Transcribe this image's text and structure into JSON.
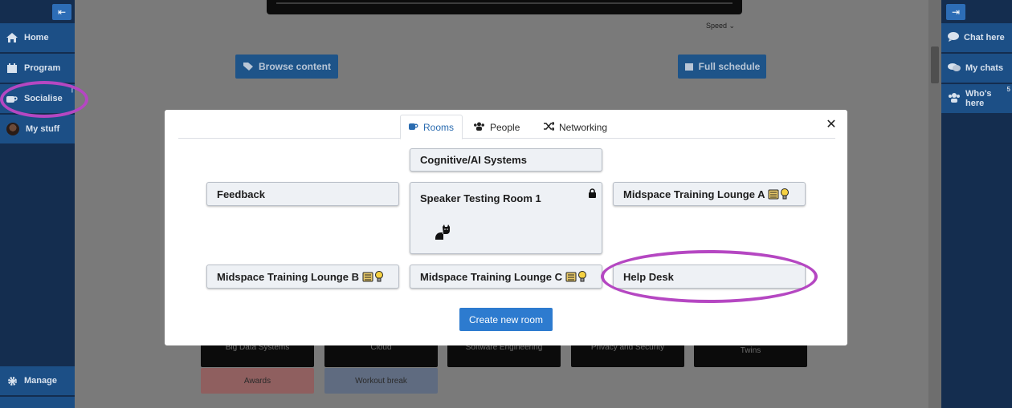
{
  "left_sidebar": {
    "collapse_label": "⇤",
    "items": [
      {
        "label": "Home",
        "icon": "home-icon"
      },
      {
        "label": "Program",
        "icon": "calendar-icon"
      },
      {
        "label": "Socialise",
        "icon": "coffee-icon"
      },
      {
        "label": "My stuff",
        "icon": "avatar"
      },
      {
        "label": "Manage",
        "icon": "gear-icon"
      }
    ]
  },
  "right_sidebar": {
    "items": [
      {
        "label": "Chat here",
        "icon": "chat-icon"
      },
      {
        "label": "My chats",
        "icon": "chats-icon"
      },
      {
        "label": "Who's here",
        "icon": "users-icon",
        "badge": "5"
      }
    ]
  },
  "video": {
    "speed_label": "Speed"
  },
  "main_buttons": {
    "browse_label": "Browse content",
    "schedule_label": "Full schedule"
  },
  "background_tiles": {
    "row1": [
      "Big Data Systems",
      "Cloud",
      "Software Engineering",
      "Privacy and Security",
      "Twins"
    ],
    "awards": "Awards",
    "workout": "Workout break"
  },
  "modal": {
    "tabs": [
      {
        "label": "Rooms",
        "active": true
      },
      {
        "label": "People",
        "active": false
      },
      {
        "label": "Networking",
        "active": false
      }
    ],
    "rooms": {
      "cognitive": "Cognitive/AI Systems",
      "feedback": "Feedback",
      "speaker": "Speaker Testing Room 1",
      "lounge_a": "Midspace Training Lounge A",
      "lounge_b": "Midspace Training Lounge B",
      "lounge_c": "Midspace Training Lounge C",
      "help_desk": "Help Desk"
    },
    "create_label": "Create new room"
  },
  "colors": {
    "accent": "#2d7bcf",
    "sidebar": "#1c4f86",
    "annotation": "#b547c2"
  }
}
